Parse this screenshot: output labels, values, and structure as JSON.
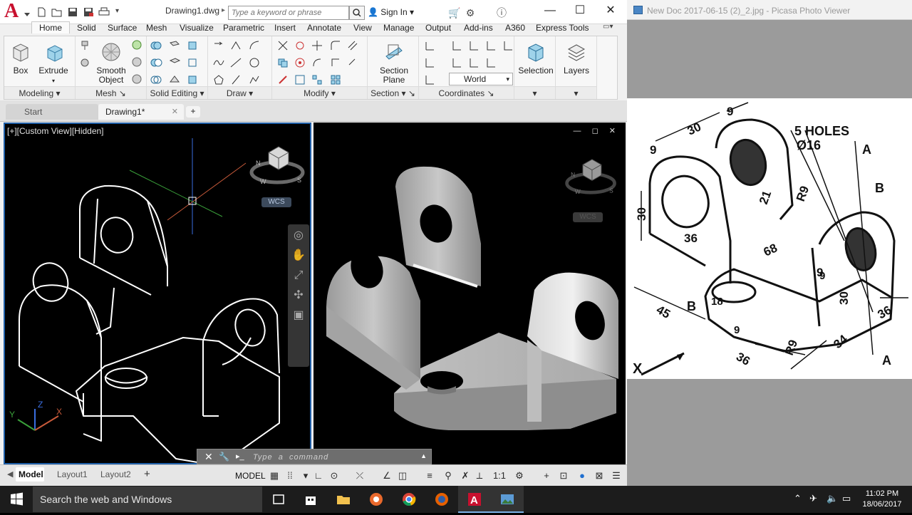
{
  "acad": {
    "doc_title": "Drawing1.dwg",
    "search_placeholder": "Type a keyword or phrase",
    "sign_in": "Sign In",
    "ribbon_tabs": [
      "Home",
      "Solid",
      "Surface",
      "Mesh",
      "Visualize",
      "Parametric",
      "Insert",
      "Annotate",
      "View",
      "Manage",
      "Output",
      "Add-ins",
      "A360",
      "Express Tools"
    ],
    "active_tab": "Home",
    "modeling": {
      "box": "Box",
      "extrude": "Extrude",
      "title": "Modeling"
    },
    "mesh": {
      "smooth_1": "Smooth",
      "smooth_2": "Object",
      "title": "Mesh"
    },
    "solid_editing": {
      "title": "Solid Editing"
    },
    "draw": {
      "title": "Draw"
    },
    "modify": {
      "title": "Modify"
    },
    "section": {
      "plane_1": "Section",
      "plane_2": "Plane",
      "title": "Section"
    },
    "coordinates": {
      "ucs_value": "World",
      "title": "Coordinates"
    },
    "selection": {
      "label": "Selection"
    },
    "layers": {
      "label": "Layers"
    },
    "file_tabs": {
      "start": "Start",
      "drawing": "Drawing1*"
    },
    "viewport": {
      "label": "[+][Custom View][Hidden]",
      "wcs": "WCS"
    },
    "command": {
      "placeholder": "Type  a  command"
    },
    "layout_tabs": [
      "Model",
      "Layout1",
      "Layout2"
    ],
    "status": {
      "model": "MODEL",
      "scale": "1:1"
    }
  },
  "picasa": {
    "title": "New Doc 2017-06-15 (2)_2.jpg - Picasa Photo Viewer",
    "drawing_labels": {
      "holes": "5 HOLES",
      "hole_dia": "Ø16",
      "dims": [
        "9",
        "30",
        "9",
        "30",
        "36",
        "21",
        "R9",
        "68",
        "9",
        "30",
        "36",
        "18",
        "45",
        "9",
        "R9",
        "36",
        "34",
        "9"
      ],
      "letters": [
        "A",
        "B",
        "B",
        "A",
        "X"
      ]
    }
  },
  "taskbar": {
    "search_placeholder": "Search the web and Windows",
    "time": "11:02 PM",
    "date": "18/06/2017"
  }
}
